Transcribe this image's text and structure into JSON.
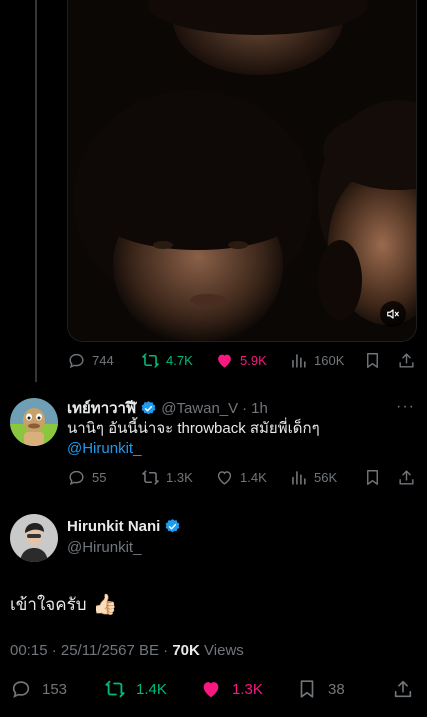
{
  "media_tweet": {
    "replies": "744",
    "retweets": "4.7K",
    "likes": "5.9K",
    "views": "160K"
  },
  "reply": {
    "name": "เทย์ทาวาฬี",
    "handle": "@Tawan_V",
    "separator": "·",
    "time": "1h",
    "more": "···",
    "text": "นานิๆ อันนี้น่าจะ throwback สมัยพี่เด็กๆ",
    "mention": "@Hirunkit_",
    "stats": {
      "replies": "55",
      "retweets": "1.3K",
      "likes": "1.4K",
      "views": "56K"
    }
  },
  "main_tweet": {
    "name": "Hirunkit Nani",
    "handle": "@Hirunkit_",
    "text": "เข้าใจครับ",
    "emoji": "👍🏻",
    "timestamp": "00:15 · 25/11/2567 BE ·",
    "views_count": "70K",
    "views_label": "Views",
    "stats": {
      "replies": "153",
      "retweets": "1.4K",
      "likes": "1.3K",
      "bookmarks": "38"
    }
  },
  "colors": {
    "background": "#000000",
    "text": "#e7e9ea",
    "muted": "#71767b",
    "retweet": "#00ba7c",
    "like": "#f91880",
    "link": "#1d9bf0",
    "verified": "#1d9bf0"
  },
  "icons": [
    "reply-icon",
    "retweet-icon",
    "heart-icon",
    "views-icon",
    "bookmark-icon",
    "share-icon",
    "mute-icon",
    "verified-badge-icon",
    "more-icon"
  ]
}
